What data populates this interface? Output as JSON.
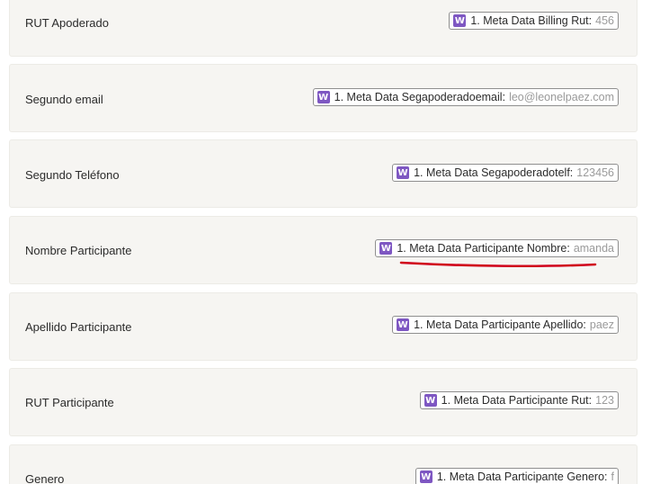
{
  "rows": [
    {
      "label": "RUT Apoderado",
      "field": "1. Meta Data Billing Rut",
      "value": "456"
    },
    {
      "label": "Segundo email",
      "field": "1. Meta Data Segapoderadoemail",
      "value": "leo@leonelpaez.com"
    },
    {
      "label": "Segundo Teléfono",
      "field": "1. Meta Data Segapoderadotelf",
      "value": "123456"
    },
    {
      "label": "Nombre Participante",
      "field": "1. Meta Data Participante Nombre",
      "value": "amanda"
    },
    {
      "label": "Apellido Participante",
      "field": "1. Meta Data Participante Apellido",
      "value": "paez"
    },
    {
      "label": "RUT Participante",
      "field": "1. Meta Data Participante Rut",
      "value": "123"
    },
    {
      "label": "Genero",
      "field": "1. Meta Data Participante Genero",
      "value": "f"
    }
  ],
  "icon": {
    "name": "woocommerce-icon",
    "glyph": "W",
    "color": "#7e57c2"
  },
  "annotation": {
    "color": "#d0021b",
    "target_row": 3
  }
}
